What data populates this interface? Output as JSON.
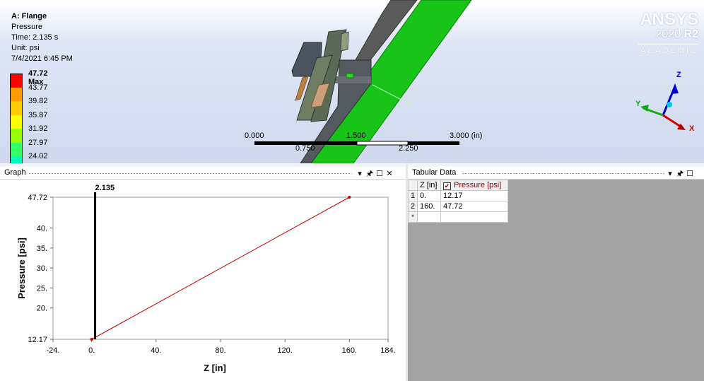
{
  "viewport": {
    "model_info": {
      "title": "A: Flange",
      "result_type": "Pressure",
      "time": "Time: 2.135 s",
      "unit": "Unit: psi",
      "date": "7/4/2021 6:45 PM"
    },
    "legend": [
      {
        "label": "47.72 Max",
        "color": "#ff0000",
        "is_max": true
      },
      {
        "label": "43.77",
        "color": "#ff9900"
      },
      {
        "label": "39.82",
        "color": "#ffcc00"
      },
      {
        "label": "35.87",
        "color": "#ffff00"
      },
      {
        "label": "31.92",
        "color": "#99ff00"
      },
      {
        "label": "27.97",
        "color": "#33ff66"
      },
      {
        "label": "24.02",
        "color": "#00ffbb"
      }
    ],
    "logo": {
      "brand": "ANSYS",
      "version_year": "2020",
      "version_rel": "R2",
      "edition": "ACADEMIC"
    },
    "scale_bar": {
      "top_labels": [
        "0.000",
        "1.500",
        "3.000 (in)"
      ],
      "bottom_labels": [
        "0.750",
        "2.250"
      ]
    },
    "triad": {
      "z": "Z",
      "y": "Y",
      "x": "X"
    }
  },
  "graph_panel": {
    "title": "Graph",
    "icons": [
      "dropdown-icon",
      "pin-icon",
      "maximize-icon",
      "close-icon"
    ],
    "chart_data": {
      "type": "line",
      "title": "",
      "xlabel": "Z [in]",
      "ylabel": "Pressure [psi]",
      "xlim": [
        -24,
        184
      ],
      "ylim": [
        12.17,
        47.72
      ],
      "x_ticks": [
        "-24.",
        "0.",
        "40.",
        "80.",
        "120.",
        "160.",
        "184."
      ],
      "x_tick_values": [
        -24,
        0,
        40,
        80,
        120,
        160,
        184
      ],
      "y_ticks": [
        "12.17",
        "20.",
        "25.",
        "30.",
        "35.",
        "40.",
        "47.72"
      ],
      "y_tick_values": [
        12.17,
        20,
        25,
        30,
        35,
        40,
        47.72
      ],
      "series": [
        {
          "x": [
            0,
            160
          ],
          "y": [
            12.17,
            47.72
          ],
          "color": "#c00000"
        }
      ],
      "cursor": {
        "x": 2.135,
        "label": "2.135"
      },
      "grid": false
    }
  },
  "tabular_panel": {
    "title": "Tabular Data",
    "icons": [
      "dropdown-icon",
      "pin-icon",
      "maximize-icon",
      "close-icon"
    ],
    "columns": [
      "Z [in]",
      "Pressure [psi]"
    ],
    "pressure_checked": true,
    "rows": [
      {
        "index": "1",
        "z": "0.",
        "pressure": "12.17"
      },
      {
        "index": "2",
        "z": "160.",
        "pressure": "47.72"
      }
    ],
    "new_row_marker": "*"
  }
}
